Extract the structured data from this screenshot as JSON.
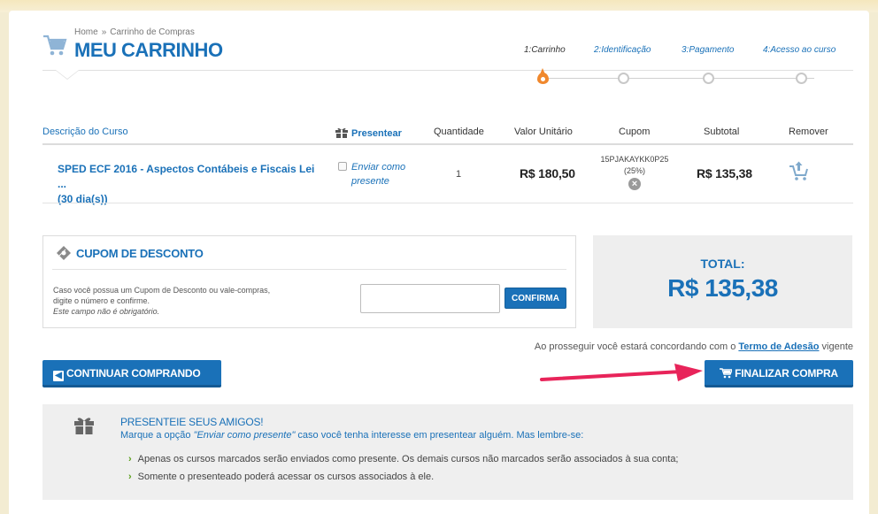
{
  "breadcrumb": {
    "home": "Home",
    "separator": "»",
    "current": "Carrinho de Compras"
  },
  "page_title": "MEU CARRINHO",
  "steps": [
    {
      "label": "1:Carrinho",
      "active": true
    },
    {
      "label": "2:Identificação",
      "active": false
    },
    {
      "label": "3:Pagamento",
      "active": false
    },
    {
      "label": "4:Acesso ao curso",
      "active": false
    }
  ],
  "table": {
    "headers": {
      "description": "Descrição do Curso",
      "gift": "Presentear",
      "quantity": "Quantidade",
      "unit_price": "Valor Unitário",
      "coupon": "Cupom",
      "subtotal": "Subtotal",
      "remove": "Remover"
    },
    "rows": [
      {
        "course_line1": "SPED ECF 2016 - Aspectos Contábeis e Fiscais Lei ...",
        "course_line2": "(30 dia(s))",
        "gift_line1": "Enviar como",
        "gift_line2": "presente",
        "quantity": "1",
        "unit_price": "R$ 180,50",
        "coupon_code": "15PJAKAYKK0P25",
        "coupon_pct": "(25%)",
        "coupon_remove": "×",
        "subtotal": "R$ 135,38"
      }
    ]
  },
  "coupon": {
    "title": "CUPOM DE DESCONTO",
    "desc_line1": "Caso você possua um Cupom de Desconto ou vale-compras,",
    "desc_line2": "digite o número e confirme.",
    "desc_optional": "Este campo não é obrigatório.",
    "input_value": "",
    "confirm_label": "CONFIRMA"
  },
  "total": {
    "label": "TOTAL:",
    "value": "R$ 135,38"
  },
  "terms": {
    "prefix": "Ao prosseguir você estará concordando com o ",
    "link": "Termo de Adesão",
    "suffix": " vigente"
  },
  "buttons": {
    "continue_label": "CONTINUAR COMPRANDO",
    "finish_label": "FINALIZAR COMPRA"
  },
  "gift_panel": {
    "title": "PRESENTEIE SEUS AMIGOS!",
    "desc_prefix": "Marque a opção ",
    "desc_option": "\"Enviar como presente\"",
    "desc_suffix": " caso você tenha interesse em presentear alguém. Mas lembre-se:",
    "items": [
      "Apenas os cursos marcados serão enviados como presente. Os demais cursos não marcados serão associados à sua conta;",
      "Somente o presenteado poderá acessar os cursos associados à ele."
    ]
  },
  "colors": {
    "brand_blue": "#1a71b8",
    "step_active": "#f0882d",
    "arrow": "#e8245a",
    "bullet": "#5a9e1a"
  }
}
